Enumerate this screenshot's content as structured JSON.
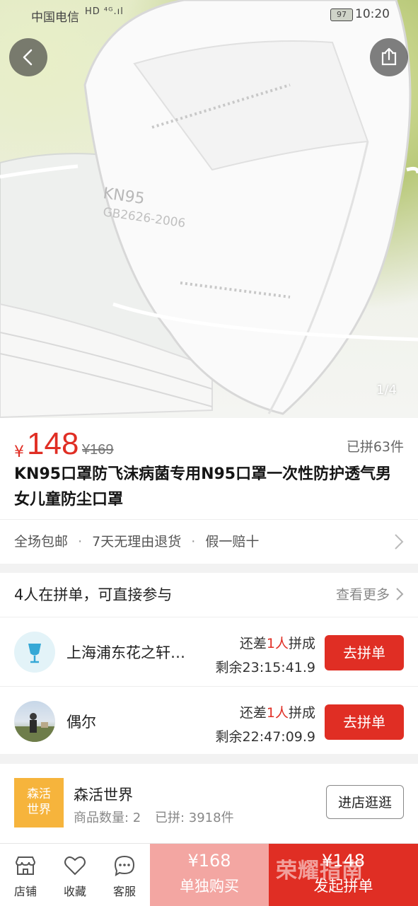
{
  "status_bar": {
    "carrier": "中国电信",
    "network": "HD ⁴ᴳ.ıl",
    "battery": "97",
    "time": "10:20"
  },
  "hero": {
    "mask_print_1": "KN95",
    "mask_print_2": "GB2626-2006",
    "page_indicator": "1/4"
  },
  "product": {
    "currency": "¥",
    "price": "148",
    "original_price": "¥169",
    "sold": "已拼63件",
    "title": "KN95口罩防飞沫病菌专用N95口罩一次性防护透气男女儿童防尘口罩",
    "services": [
      "全场包邮",
      "7天无理由退货",
      "假一赔十"
    ],
    "service_sep": "·"
  },
  "group": {
    "header": "4人在拼单，可直接参与",
    "more": "查看更多",
    "items": [
      {
        "name": "上海浦东花之轩…",
        "need_prefix": "还差",
        "need_count": "1人",
        "need_suffix": "拼成",
        "remain": "剩余23:15:41.9",
        "button": "去拼单"
      },
      {
        "name": "偶尔",
        "need_prefix": "还差",
        "need_count": "1人",
        "need_suffix": "拼成",
        "remain": "剩余22:47:09.9",
        "button": "去拼单"
      }
    ]
  },
  "shop": {
    "logo_line1": "森活",
    "logo_line2": "世界",
    "name": "森活世界",
    "goods_count": "商品数量: 2",
    "sold": "已拼: 3918件",
    "button": "进店逛逛"
  },
  "bottom_bar": {
    "tabs": [
      {
        "label": "店铺",
        "icon": "store-icon"
      },
      {
        "label": "收藏",
        "icon": "heart-icon"
      },
      {
        "label": "客服",
        "icon": "chat-icon"
      }
    ],
    "single_price": "¥168",
    "single_label": "单独购买",
    "group_price": "¥148",
    "group_label": "发起拼单"
  },
  "watermark": "荣耀指南",
  "colors": {
    "accent": "#e02e24",
    "accent_light": "#f3a6a2",
    "shop_logo": "#f6b43c"
  }
}
